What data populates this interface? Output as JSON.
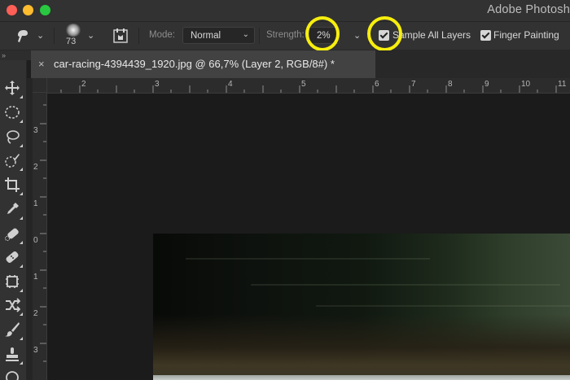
{
  "window": {
    "app_title": "Adobe Photosh"
  },
  "options_bar": {
    "brush_size": "73",
    "mode_label": "Mode:",
    "mode_value": "Normal",
    "strength_label": "Strength:",
    "strength_value": "2%",
    "sample_all_layers_label": "Sample All Layers",
    "sample_all_layers_checked": true,
    "finger_painting_label": "Finger Painting",
    "finger_painting_checked": true,
    "highlight_color": "#f7ee0e"
  },
  "collapse_glyph": "»",
  "document_tab": {
    "close_glyph": "×",
    "title": "car-racing-4394439_1920.jpg @ 66,7% (Layer 2, RGB/8#) *"
  },
  "ruler_top_numbers": [
    "2",
    "3",
    "4",
    "5",
    "6",
    "7",
    "8",
    "9",
    "10",
    "11"
  ],
  "ruler_left_numbers": [
    "3",
    "2",
    "1",
    "0",
    "1",
    "2",
    "3"
  ],
  "toolbar_tools": [
    "move-tool",
    "marquee-tool",
    "lasso-tool",
    "quick-selection-tool",
    "crop-tool",
    "eyedropper-tool",
    "spot-healing-tool",
    "bandage-tool",
    "frame-tool",
    "content-aware-move-tool",
    "brush-tool",
    "stamp-tool",
    "history-brush-tool"
  ]
}
